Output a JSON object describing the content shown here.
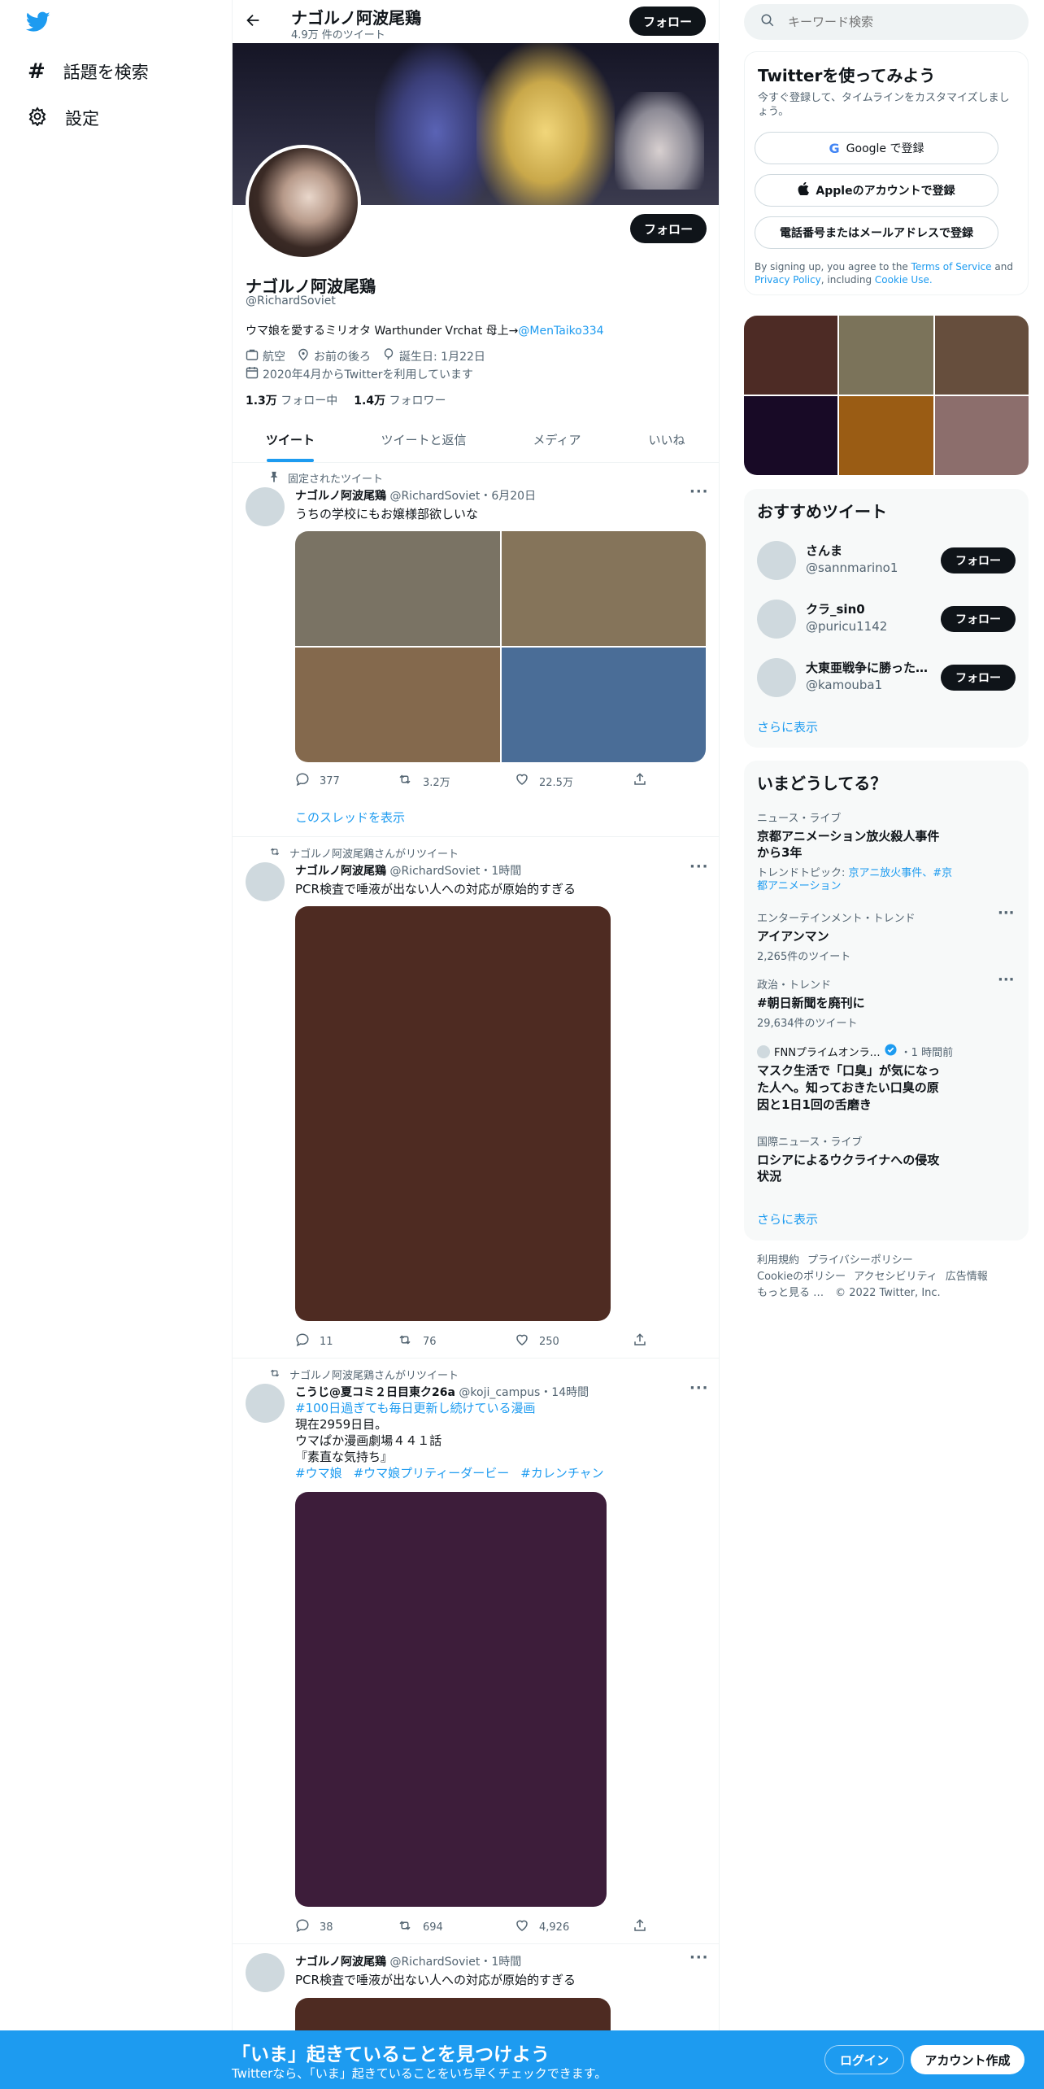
{
  "nav": {
    "explore_label": "話題を検索",
    "settings_label": "設定"
  },
  "header": {
    "name": "ナゴルノ阿波尾鶏",
    "tweet_count": "4.9万 件のツイート",
    "follow_label": "フォロー"
  },
  "profile": {
    "name": "ナゴルノ阿波尾鶏",
    "handle": "@RichardSoviet",
    "follow_label": "フォロー",
    "bio_text": "ウマ娘を愛するミリオタ Warthunder Vrchat 母上→",
    "bio_link": "@MenTaiko334",
    "category": "航空",
    "location": "お前の後ろ",
    "birthday": "誕生日: 1月22日",
    "joined": "2020年4月からTwitterを利用しています",
    "following_count": "1.3万",
    "following_label": "フォロー中",
    "followers_count": "1.4万",
    "followers_label": "フォロワー"
  },
  "tabs": [
    "ツイート",
    "ツイートと返信",
    "メディア",
    "いいね"
  ],
  "tweets": [
    {
      "context": "固定されたツイート",
      "name": "ナゴルノ阿波尾鶏",
      "handle": "@RichardSoviet",
      "time": "・6月20日",
      "text": "うちの学校にもお嬢様部欲しいな",
      "replies": "377",
      "retweets": "3.2万",
      "likes": "22.5万",
      "thread_link": "このスレッドを表示",
      "media_colors": [
        "#7a7364",
        "#85745a",
        "#84694d",
        "#4a6d97"
      ]
    },
    {
      "context": "ナゴルノ阿波尾鶏さんがリツイート",
      "name": "ナゴルノ阿波尾鶏",
      "handle": "@RichardSoviet",
      "time": "・1時間",
      "text": "PCR検査で唾液が出ない人への対応が原始的すぎる",
      "replies": "11",
      "retweets": "76",
      "likes": "250",
      "media_color": "#4e2b22"
    },
    {
      "context": "ナゴルノ阿波尾鶏さんがリツイート",
      "name": "こうじ@夏コミ２日目東ク26a",
      "handle": "@koji_campus",
      "time": "・14時間",
      "hashtag_line": "#100日過ぎても毎日更新し続けている漫画",
      "line1": "現在2959日目。",
      "line2": "ウマぱか漫画劇場４４１話",
      "line3": "『素直な気持ち』",
      "tag1": "#ウマ娘",
      "tag2": "#ウマ娘プリティーダービー",
      "tag3": "#カレンチャン",
      "replies": "38",
      "retweets": "694",
      "likes": "4,926",
      "media_color": "#3d1d3a"
    },
    {
      "name": "ナゴルノ阿波尾鶏",
      "handle": "@RichardSoviet",
      "time": "・1時間",
      "text": "PCR検査で唾液が出ない人への対応が原始的すぎる",
      "media_color": "#4e2b22"
    }
  ],
  "search": {
    "placeholder": "キーワード検索"
  },
  "signup": {
    "title": "Twitterを使ってみよう",
    "subtitle": "今すぐ登録して、タイムラインをカスタマイズしましょう。",
    "google_label": "Google で登録",
    "apple_label": "Appleのアカウントで登録",
    "phone_label": "電話番号またはメールアドレスで登録",
    "terms_prefix": "By signing up, you agree to the",
    "terms_link": "Terms of Service",
    "terms_and": "and",
    "privacy_link": "Privacy Policy",
    "terms_including": ", including",
    "cookie_link": "Cookie Use."
  },
  "media_grid_colors": [
    "#4d2b25",
    "#7b735a",
    "#664e3d",
    "#180a26",
    "#9a5c14",
    "#8c6e6c"
  ],
  "recommended": {
    "title": "おすすめツイート",
    "follow_label": "フォロー",
    "users": [
      {
        "name": "さんま",
        "handle": "@sannmarino1"
      },
      {
        "name": "クラ_sin0",
        "handle": "@puricu1142"
      },
      {
        "name": "大東亜戦争に勝った…",
        "handle": "@kamouba1"
      }
    ],
    "more": "さらに表示"
  },
  "trends": {
    "title": "いまどうしてる？",
    "items": [
      {
        "category": "ニュース・ライブ",
        "title": "京都アニメーション放火殺人事件から3年",
        "topic_prefix": "トレンドトピック: ",
        "topic_links": "京アニ放火事件、#京都アニメーション"
      },
      {
        "category": "エンターテインメント・トレンド",
        "title": "アイアンマン",
        "count": "2,265件のツイート"
      },
      {
        "category": "政治・トレンド",
        "title": "#朝日新聞を廃刊に",
        "count": "29,634件のツイート"
      },
      {
        "source": "FNNプライムオンラ…",
        "time": "・1 時間前",
        "title": "マスク生活で「口臭」が気になった人へ。知っておきたい口臭の原因と1日1回の舌磨き"
      },
      {
        "category": "国際ニュース・ライブ",
        "title": "ロシアによるウクライナへの侵攻状況"
      }
    ],
    "more": "さらに表示"
  },
  "footer": {
    "terms": "利用規約",
    "privacy": "プライバシーポリシー",
    "cookie": "Cookieのポリシー",
    "accessibility": "アクセシビリティ",
    "ads": "広告情報",
    "more": "もっと見る …",
    "copyright": "© 2022 Twitter, Inc."
  },
  "bottom_bar": {
    "title": "「いま」起きていることを見つけよう",
    "subtitle": "Twitterなら、「いま」起きていることをいち早くチェックできます。",
    "login_label": "ログイン",
    "signup_label": "アカウント作成"
  },
  "colors": {
    "accent": "#1d9bf0",
    "dark": "#0f1419",
    "muted": "#536471"
  }
}
